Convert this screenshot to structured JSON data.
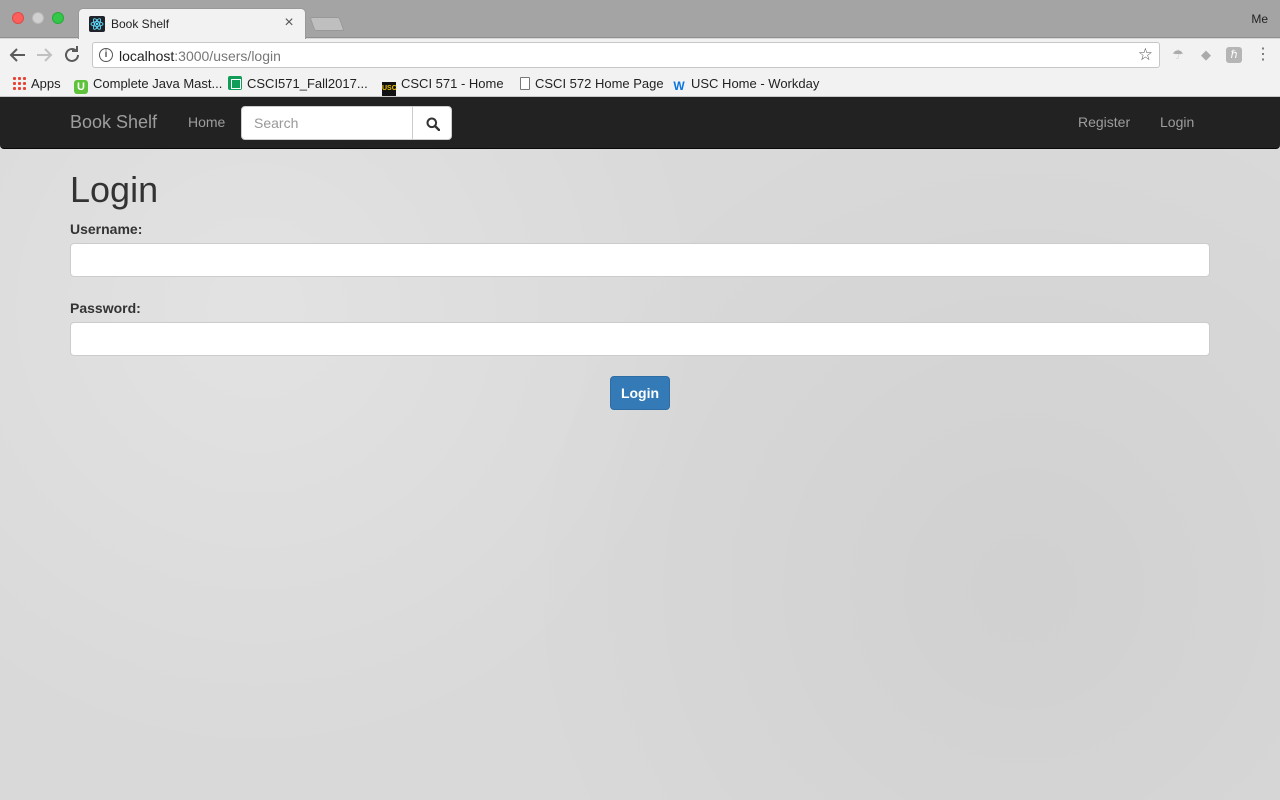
{
  "browser": {
    "tab_title": "Book Shelf",
    "tab_close": "×",
    "profile": "Me",
    "url_host": "localhost",
    "url_path": ":3000/users/login",
    "bookmarks": [
      {
        "label": "Apps",
        "icon": "apps-grid-icon"
      },
      {
        "label": "Complete Java Mast...",
        "icon": "udemy-icon"
      },
      {
        "label": "CSCI571_Fall2017...",
        "icon": "sheets-icon"
      },
      {
        "label": "CSCI 571 - Home",
        "icon": "usc-icon"
      },
      {
        "label": "CSCI 572 Home Page",
        "icon": "document-icon"
      },
      {
        "label": "USC Home - Workday",
        "icon": "workday-icon"
      }
    ]
  },
  "navbar": {
    "brand": "Book Shelf",
    "home": "Home",
    "search_placeholder": "Search",
    "register": "Register",
    "login": "Login"
  },
  "form": {
    "title": "Login",
    "username_label": "Username:",
    "password_label": "Password:",
    "username_value": "",
    "password_value": "",
    "submit_label": "Login"
  },
  "colors": {
    "navbar_bg": "#222222",
    "primary_button": "#337ab7"
  }
}
